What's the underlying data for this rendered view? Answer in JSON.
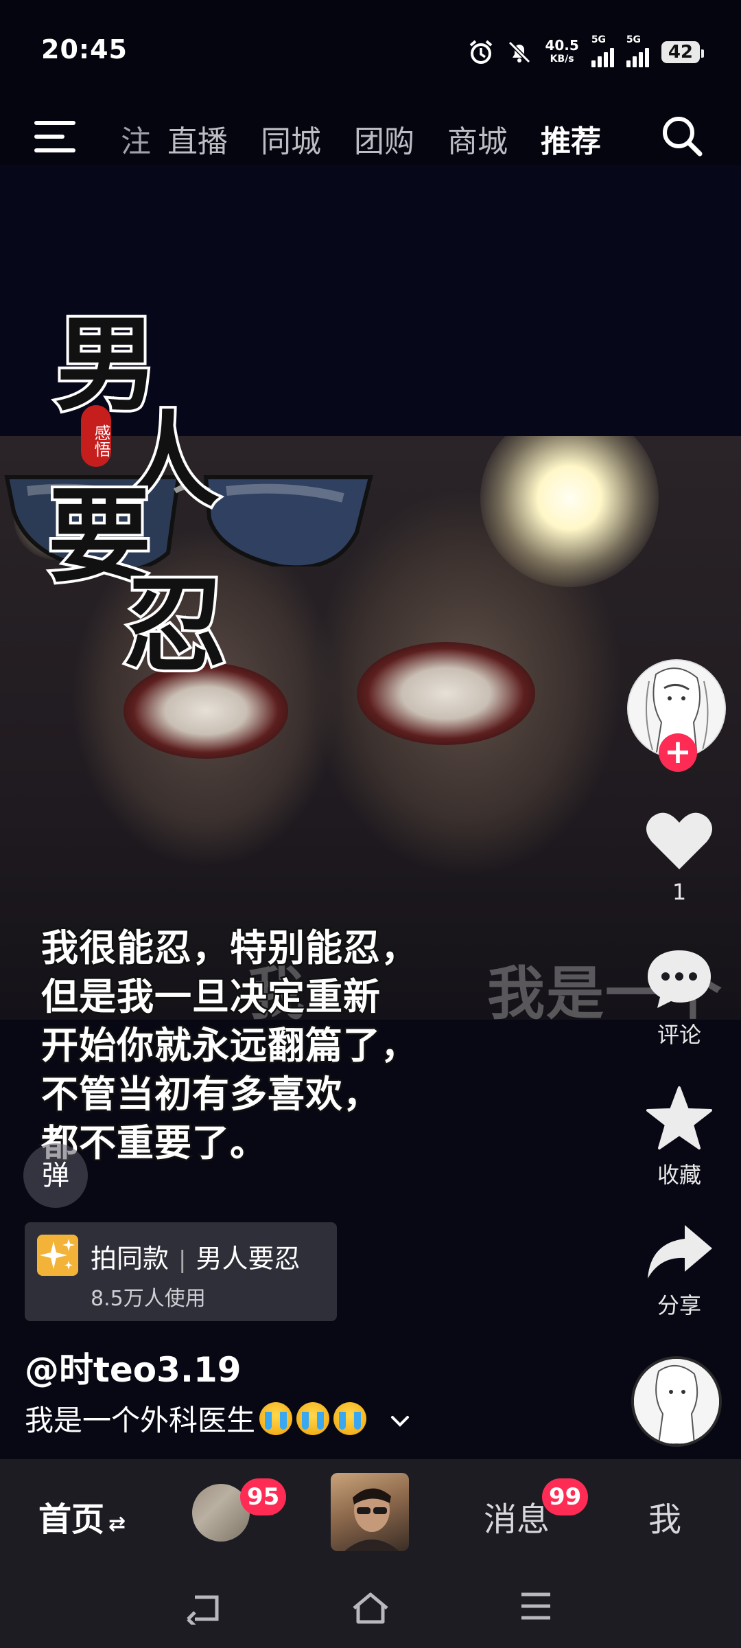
{
  "status_bar": {
    "time": "20:45",
    "net_speed": "40.5",
    "net_speed_unit": "KB/s",
    "sim1_label": "5G",
    "sim2_label": "5G",
    "battery": "42"
  },
  "top_nav": {
    "tabs": [
      {
        "label": "关注",
        "visible_label": "注"
      },
      {
        "label": "直播"
      },
      {
        "label": "同城"
      },
      {
        "label": "团购"
      },
      {
        "label": "商城"
      },
      {
        "label": "推荐"
      }
    ],
    "active_tab": "推荐"
  },
  "video": {
    "title_art": [
      "男",
      "人",
      "要",
      "忍"
    ],
    "title_stamp": "感悟",
    "background_text": "我是一个",
    "subtitle": "我很能忍，特别能忍，\n但是我一旦决定重新\n开始你就永远翻篇了，\n不管当初有多喜欢，\n都不重要了。"
  },
  "actions": {
    "follow_symbol": "+",
    "like_count": "1",
    "comment_label": "评论",
    "favorite_label": "收藏",
    "share_label": "分享"
  },
  "danmaku_label": "弹",
  "template_card": {
    "action": "拍同款",
    "name": "男人要忍",
    "usage": "8.5万人使用"
  },
  "author": "@时teo3.19",
  "caption": "我是一个外科医生",
  "bottom_nav": {
    "home": "首页",
    "home_switch": "⇄",
    "friends_badge": "95",
    "messages": "消息",
    "messages_badge": "99",
    "me": "我"
  },
  "icons": {
    "menu": "menu-icon",
    "search": "search-icon",
    "like": "heart-icon",
    "comment": "comment-icon",
    "favorite": "star-icon",
    "share": "share-icon",
    "back": "back-icon",
    "home": "home-icon",
    "recents": "recents-icon"
  },
  "colors": {
    "background": "#05050f",
    "accent": "#fe2c55",
    "template_icon": "#f2b338",
    "bottom_bar": "#1c1c22"
  }
}
